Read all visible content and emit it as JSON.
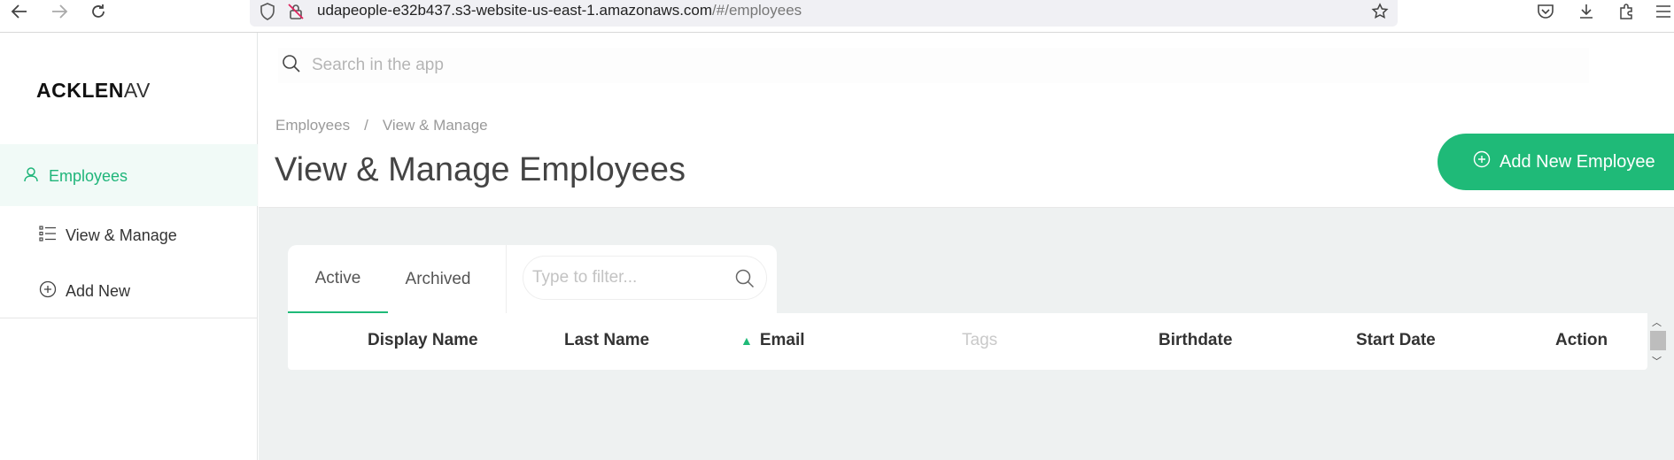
{
  "browser": {
    "url_host": "udapeople-e32b437.s3-website-us-east-1.amazonaws.com",
    "url_path": "/#/employees"
  },
  "sidebar": {
    "logo_main": "ACKLEN",
    "logo_suffix": "AV",
    "items": [
      {
        "label": "Employees",
        "icon": "user-icon",
        "active": true
      },
      {
        "label": "View & Manage",
        "icon": "list-icon",
        "active": false
      },
      {
        "label": "Add New",
        "icon": "plus-circle-icon",
        "active": false
      }
    ]
  },
  "search": {
    "placeholder": "Search in the app"
  },
  "header": {
    "breadcrumb": [
      "Employees",
      "/",
      "View & Manage"
    ],
    "title": "View & Manage Employees",
    "add_button": "Add New Employee"
  },
  "tabs": [
    {
      "label": "Active",
      "active": true
    },
    {
      "label": "Archived",
      "active": false
    }
  ],
  "filter": {
    "placeholder": "Type to filter..."
  },
  "table": {
    "columns": [
      "Display Name",
      "Last Name",
      "Email",
      "Tags",
      "Birthdate",
      "Start Date",
      "Action"
    ],
    "sorted_column": "Email",
    "sort_direction": "ascending"
  },
  "colors": {
    "accent": "#1fba78",
    "content_bg": "#eef1f1"
  }
}
